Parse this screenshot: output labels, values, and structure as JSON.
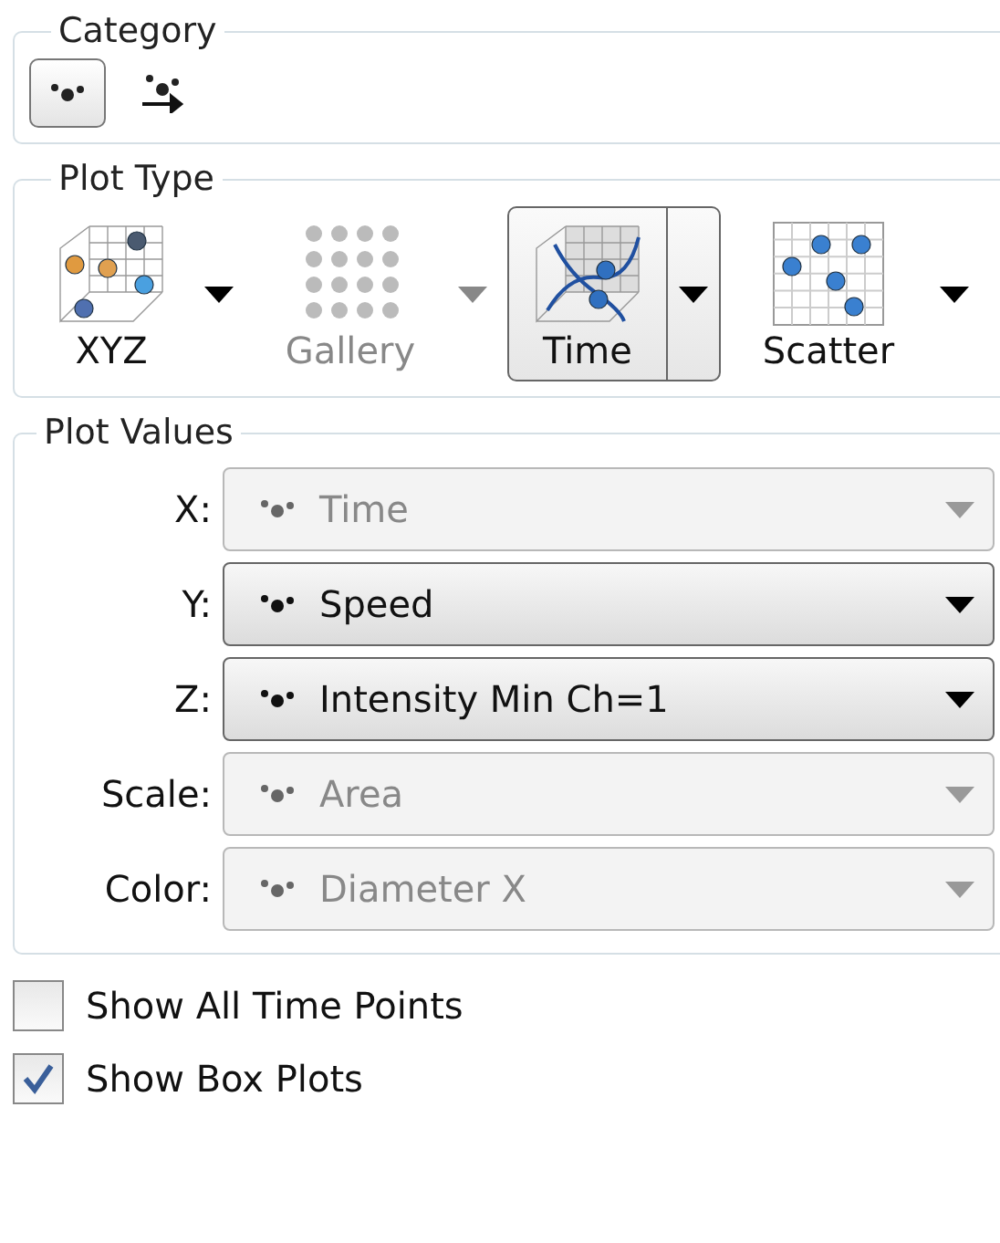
{
  "category": {
    "title": "Category",
    "options": [
      {
        "kind": "single",
        "selected": true
      },
      {
        "kind": "track",
        "selected": false
      }
    ]
  },
  "plot_type": {
    "title": "Plot Type",
    "items": [
      {
        "kind": "xyz",
        "label": "XYZ",
        "selected": false,
        "disabled": false
      },
      {
        "kind": "gallery",
        "label": "Gallery",
        "selected": false,
        "disabled": true
      },
      {
        "kind": "time",
        "label": "Time",
        "selected": true,
        "disabled": false
      },
      {
        "kind": "scatter",
        "label": "Scatter",
        "selected": false,
        "disabled": false
      }
    ]
  },
  "plot_values": {
    "title": "Plot Values",
    "rows": [
      {
        "label": "X:",
        "value": "Time",
        "disabled": true
      },
      {
        "label": "Y:",
        "value": "Speed",
        "disabled": false
      },
      {
        "label": "Z:",
        "value": "Intensity Min Ch=1",
        "disabled": false
      },
      {
        "label": "Scale:",
        "value": "Area",
        "disabled": true
      },
      {
        "label": "Color:",
        "value": "Diameter X",
        "disabled": true
      }
    ]
  },
  "options": [
    {
      "label": "Show All Time Points",
      "checked": false
    },
    {
      "label": "Show Box Plots",
      "checked": true
    }
  ]
}
